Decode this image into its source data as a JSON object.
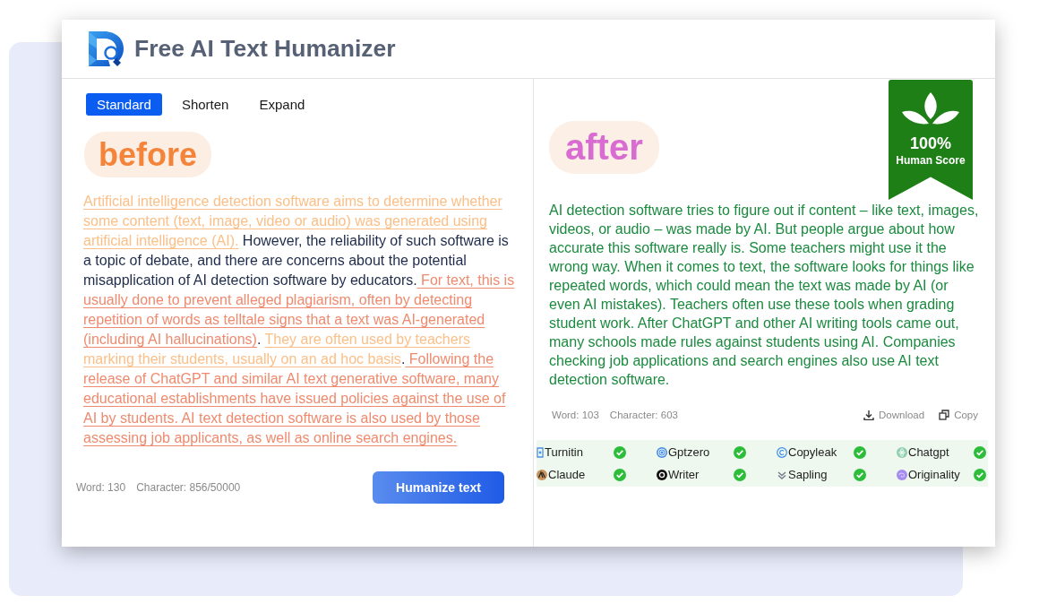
{
  "header": {
    "title": "Free AI Text Humanizer"
  },
  "modes": [
    {
      "label": "Standard",
      "selected": true
    },
    {
      "label": "Shorten",
      "selected": false
    },
    {
      "label": "Expand",
      "selected": false
    }
  ],
  "input": {
    "tag": "before",
    "segments": [
      {
        "text": "Artificial intelligence detection software aims to determine whether some content (text, image, video or audio) was generated using artificial intelligence (AI).",
        "kind": "light"
      },
      {
        "text": " However, the reliability of such software is a topic of debate, and there are concerns about the potential misapplication of AI detection software by educators.",
        "kind": "plain"
      },
      {
        "text": " For text, this is usually done to prevent alleged plagiarism, often by detecting repetition of words as telltale signs that a text was AI-generated (including AI hallucinations)",
        "kind": "strong"
      },
      {
        "text": ". ",
        "kind": "plain"
      },
      {
        "text": "They are often used by teachers marking their students, usually on an ad hoc basis",
        "kind": "light"
      },
      {
        "text": ".",
        "kind": "plain"
      },
      {
        "text": " Following the release of ChatGPT and similar AI text generative software, many educational establishments have issued policies against the use of AI by students. AI text detection software is also used by those assessing job applicants, as well as online search engines.",
        "kind": "strong"
      }
    ],
    "word_count": "Word: 130",
    "character_count": "Character: 856/50000",
    "button": "Humanize text"
  },
  "output": {
    "tag": "after",
    "score": {
      "value": "100%",
      "label": "Human Score"
    },
    "text": "AI detection software tries to figure out if content – like text, images, videos, or audio – was made by AI. But people argue about how accurate this software really is. Some teachers might use it the wrong way. When it comes to text, the software looks for things like repeated words, which could mean the text was made by AI (or even AI mistakes). Teachers often use these tools when grading student work. After ChatGPT and other AI writing tools came out, many schools made rules against students using AI. Companies checking job applications and search engines also use AI text detection software.",
    "word_count": "Word: 103",
    "character_count": "Character: 603",
    "actions": [
      {
        "label": "Download",
        "kind": "download"
      },
      {
        "label": "Copy",
        "kind": "copy"
      }
    ],
    "detectors": [
      {
        "name": "Turnitin",
        "kind": "turnitin",
        "passed": true
      },
      {
        "name": "Gptzero",
        "kind": "gptzero",
        "passed": true
      },
      {
        "name": "Copyleak",
        "kind": "copyleak",
        "passed": true
      },
      {
        "name": "Chatgpt",
        "kind": "chatgpt",
        "passed": true
      },
      {
        "name": "Claude",
        "kind": "claude",
        "passed": true
      },
      {
        "name": "Writer",
        "kind": "writer",
        "passed": true
      },
      {
        "name": "Sapling",
        "kind": "sapling",
        "passed": true
      },
      {
        "name": "Originality",
        "kind": "originality",
        "passed": true
      }
    ]
  }
}
